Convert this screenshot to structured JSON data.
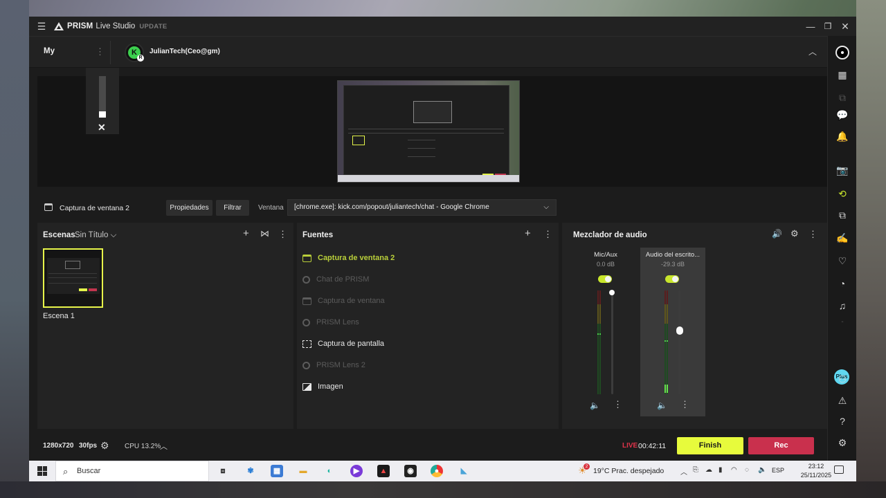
{
  "titlebar": {
    "app_name_bold": "PRISM",
    "app_name_rest": "Live Studio",
    "update_label": "UPDATE"
  },
  "channel_bar": {
    "my_label": "My",
    "channel_name": "JulianTech(Ceo@gm)",
    "avatar_letter": "K",
    "avatar_badge": "R"
  },
  "source_toolbar": {
    "source_name": "Captura de ventana 2",
    "properties_label": "Propiedades",
    "filter_label": "Filtrar",
    "window_label": "Ventana",
    "window_value": "[chrome.exe]: kick.com/popout/juliantech/chat - Google Chrome"
  },
  "scenes": {
    "title": "Escenas",
    "collection": "Sin Título",
    "items": [
      {
        "label": "Escena 1",
        "selected": true
      }
    ]
  },
  "sources": {
    "title": "Fuentes",
    "items": [
      {
        "label": "Captura de ventana 2",
        "icon": "window-icon",
        "state": "selected"
      },
      {
        "label": "Chat de PRISM",
        "icon": "gear-icon",
        "state": "hidden"
      },
      {
        "label": "Captura de ventana",
        "icon": "window-icon",
        "state": "hidden"
      },
      {
        "label": "PRISM Lens",
        "icon": "gear-icon",
        "state": "hidden"
      },
      {
        "label": "Captura de pantalla",
        "icon": "screen-capture-icon",
        "state": "visible"
      },
      {
        "label": "PRISM Lens 2",
        "icon": "gear-icon",
        "state": "hidden"
      },
      {
        "label": "Imagen",
        "icon": "image-icon",
        "state": "visible"
      }
    ]
  },
  "mixer": {
    "title": "Mezclador de audio",
    "channels": [
      {
        "name": "Mic/Aux",
        "db": "0.0 dB",
        "enabled": true,
        "active": false
      },
      {
        "name": "Audio del escrito...",
        "db": "-29.3 dB",
        "enabled": true,
        "active": true
      }
    ]
  },
  "status": {
    "resolution": "1280x720",
    "fps": "30fps",
    "cpu": "CPU 13.2%",
    "live_label": "LIVE",
    "live_time": "00:42:11",
    "finish_label": "Finish",
    "rec_label": "Rec"
  },
  "sidebar": {
    "plus_label": "Plus"
  },
  "taskbar": {
    "search_placeholder": "Buscar",
    "weather": "19°C  Prac. despejado",
    "weather_badge": "2",
    "language": "ESP",
    "time": "23:12",
    "date": "25/11/2025"
  },
  "colors": {
    "accent": "#e7fb3c",
    "rec": "#c9304d",
    "live": "#e0334a",
    "selected_source": "#b9cf3a"
  }
}
